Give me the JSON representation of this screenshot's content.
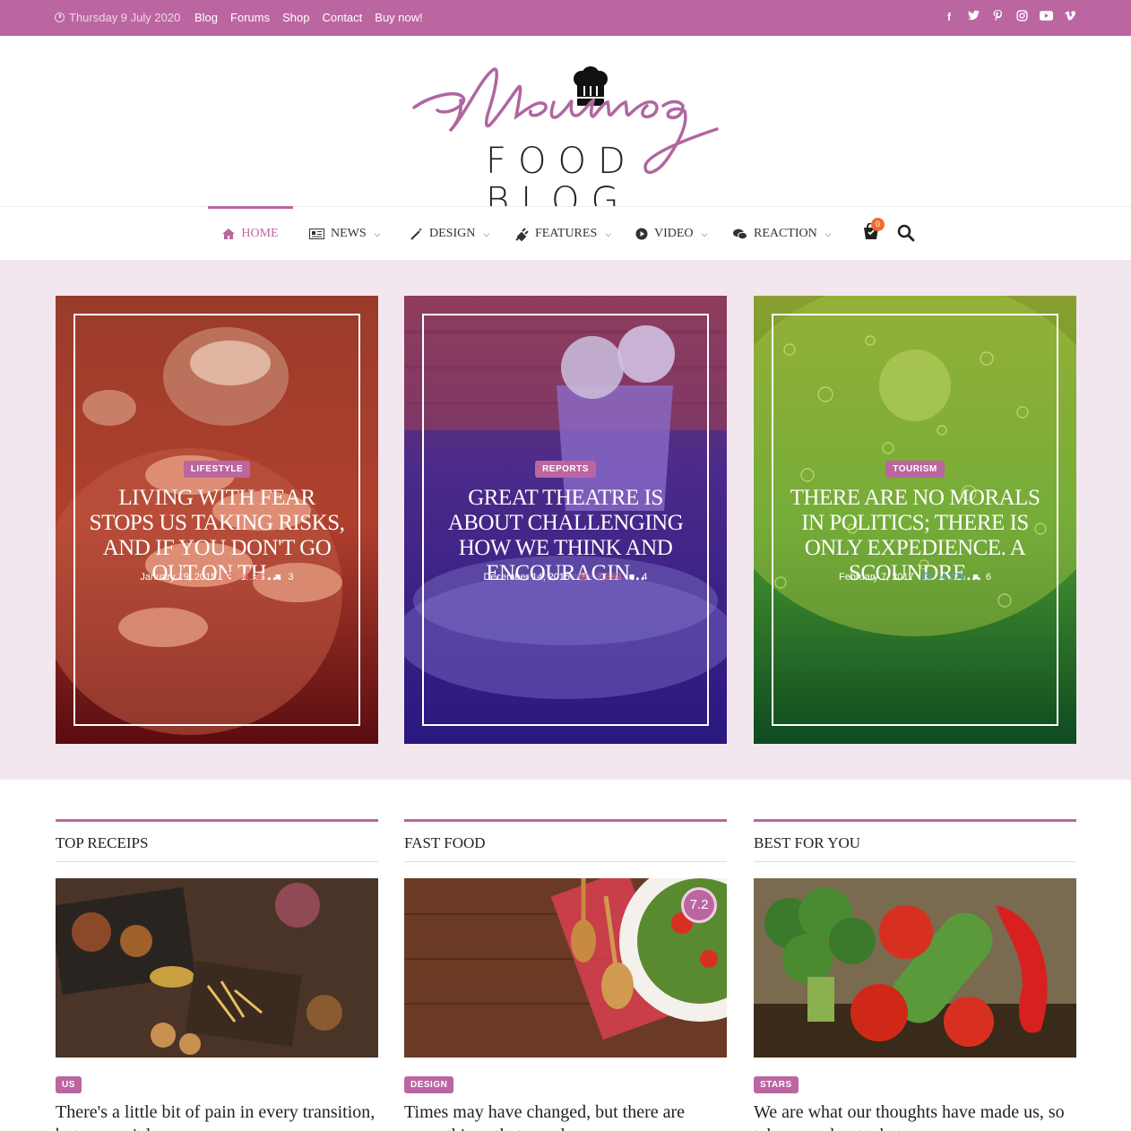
{
  "topbar": {
    "date": "Thursday 9 July 2020",
    "links": [
      "Blog",
      "Forums",
      "Shop",
      "Contact",
      "Buy now!"
    ],
    "social": [
      "facebook-icon",
      "twitter-icon",
      "pinterest-icon",
      "instagram-icon",
      "youtube-icon",
      "vimeo-icon"
    ]
  },
  "logo": {
    "script": "Meumag",
    "sub": "FOOD BLOG"
  },
  "nav": {
    "items": [
      {
        "label": "HOME",
        "icon": "home-icon"
      },
      {
        "label": "NEWS",
        "icon": "newspaper-icon"
      },
      {
        "label": "DESIGN",
        "icon": "magic-wand-icon"
      },
      {
        "label": "FEATURES",
        "icon": "plug-icon"
      },
      {
        "label": "VIDEO",
        "icon": "play-icon"
      },
      {
        "label": "REACTION",
        "icon": "chat-icon"
      }
    ],
    "cart_count": "0"
  },
  "hero": [
    {
      "category": "LIFESTYLE",
      "title": "LIVING WITH FEAR STOPS US TAKING RISKS, AND IF YOU DON'T GO OUT ON TH...",
      "date": "January 19, 2015",
      "views": "6,245",
      "comments": "3"
    },
    {
      "category": "REPORTS",
      "title": "GREAT THEATRE IS ABOUT CHALLENGING HOW WE THINK AND ENCOURAGIN...",
      "date": "December 14, 2015",
      "views": "7,383",
      "comments": "4"
    },
    {
      "category": "TOURISM",
      "title": "THERE ARE NO MORALS IN POLITICS; THERE IS ONLY EXPEDIENCE. A SCOUNDRE...",
      "date": "February 7, 2017",
      "views": "4,278",
      "comments": "6"
    }
  ],
  "sections": [
    {
      "heading": "TOP RECEIPS",
      "tag": "US",
      "title": "There's a little bit of pain in every transition, but we can't le..."
    },
    {
      "heading": "FAST FOOD",
      "tag": "DESIGN",
      "title": "Times may have changed, but there are some things that are always",
      "score": "7.2"
    },
    {
      "heading": "BEST FOR YOU",
      "tag": "STARS",
      "title": "We are what our thoughts have made us, so take care about what we"
    }
  ],
  "colors": {
    "accent": "#bb66a0",
    "hero_bg": "#f3e7ef",
    "badge": "#f06b2b"
  }
}
